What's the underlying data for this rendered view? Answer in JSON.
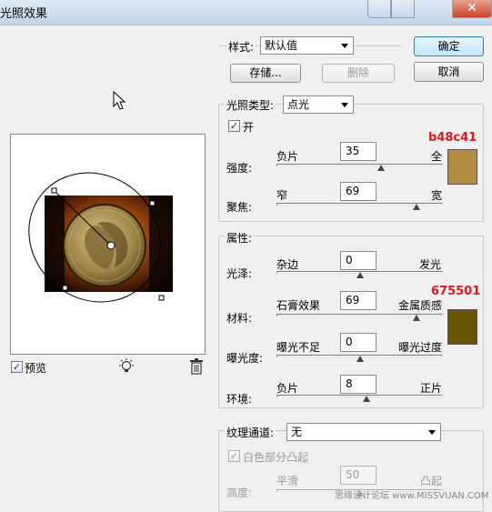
{
  "window": {
    "title": "光照效果"
  },
  "buttons": {
    "ok": "确定",
    "cancel": "取消"
  },
  "style": {
    "label": "样式:",
    "value": "默认值",
    "save": "存储...",
    "delete": "删除"
  },
  "light_type": {
    "label": "光照类型:",
    "value": "点光",
    "on_label": "开",
    "on_checked": true,
    "intensity": {
      "label": "强度:",
      "left": "负片",
      "right": "全",
      "value": "35",
      "fraction": 0.63
    },
    "focus": {
      "label": "聚焦:",
      "left": "窄",
      "right": "宽",
      "value": "69",
      "fraction": 0.84
    },
    "color_hex_label": "b48c41",
    "color": "#b48c41"
  },
  "properties": {
    "heading": "属性:",
    "gloss": {
      "label": "光泽:",
      "left": "杂边",
      "right": "发光",
      "value": "0",
      "fraction": 0.5
    },
    "material": {
      "label": "材料:",
      "left": "石膏效果",
      "right": "金属质感",
      "value": "69",
      "fraction": 0.84
    },
    "exposure": {
      "label": "曝光度:",
      "left": "曝光不足",
      "right": "曝光过度",
      "value": "0",
      "fraction": 0.5
    },
    "ambience": {
      "label": "环境:",
      "left": "负片",
      "right": "正片",
      "value": "8",
      "fraction": 0.54
    },
    "color_hex_label": "675501",
    "color": "#675501"
  },
  "texture": {
    "label": "纹理通道:",
    "value": "无",
    "white_high_label": "白色部分凸起",
    "height": {
      "label": "高度:",
      "left": "平滑",
      "right": "凸起",
      "value": "50",
      "fraction": 0.5
    }
  },
  "preview": {
    "label": "预览",
    "checked": true,
    "bulb_icon": "light-bulb-icon",
    "trash_icon": "trash-icon"
  },
  "watermark": "思缘设计论坛 www.MISSVUAN.COM"
}
